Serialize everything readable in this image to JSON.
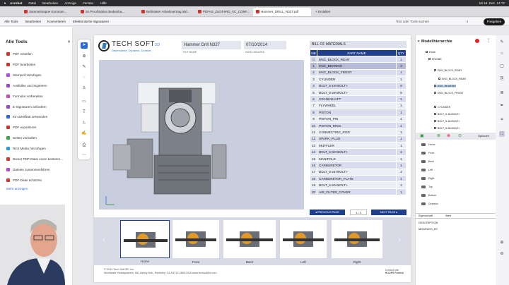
{
  "mac_menu": {
    "app": "Acrobat",
    "items": [
      "Datei",
      "Bearbeiten",
      "Anzeige",
      "Fenster",
      "Hilfe"
    ],
    "clock": "Mi 18. Dez. 14:72"
  },
  "tabs": [
    "Sammelmappe Komman...",
    "55 ProofStation Bedienha...",
    "Befristeter Arbeitsvertrag inkl...",
    "PDFAS_ZUGFeRD_XC_COMF...",
    "Hammer_DRILL_N327.pdf",
    "Erstellen"
  ],
  "menubar": {
    "items": [
      "Alle Tools",
      "Bearbeiten",
      "Konvertieren",
      "Elektronische Signaturen"
    ],
    "search": "Text oder Tools suchen",
    "share": "Freigeben"
  },
  "left_panel": {
    "title": "Alle Tools",
    "tools": [
      "PDF erstellen",
      "PDF bearbeiten",
      "Stempel hinzufügen",
      "Ausfüllen und Signieren",
      "Formular vorbereiten",
      "E-Signaturen anfordern",
      "Ein Zertifikat verwenden",
      "PDF exportieren",
      "Seiten verwalten",
      "Rich Media hinzufügen",
      "Dieser PDF-Datei einen bestimm...",
      "Dateien zusammenführen",
      "PDF-Datei schützen"
    ],
    "tool_colors": [
      "#d0342c",
      "#d0342c",
      "#b04ad0",
      "#9a45d0",
      "#c24ab8",
      "#9a45d0",
      "#2a6ad3",
      "#d0342c",
      "#38a845",
      "#2a9ad3",
      "#d0342c",
      "#b04ad0",
      "#d0342c"
    ],
    "more": "Mehr anzeigen"
  },
  "doc": {
    "brand": "TECH SOFT",
    "brand_3d": "3D",
    "slogan": "Dependable. Dynamic. Durable.",
    "file_name_value": "Hammer Drill N327",
    "file_name_label": "FILE NAME",
    "date_value": "07/10/2014",
    "date_label": "DATE CREATED",
    "bom_title": "BILL OF MATERIALS",
    "bom_headers": [
      "NB",
      "PART NAME",
      "QTY"
    ],
    "bom_rows": [
      [
        "0",
        "ENG_BLOCK_REAR",
        "1"
      ],
      [
        "1",
        "ENG_BEARING",
        "2"
      ],
      [
        "2",
        "ENG_BLOCK_FRONT",
        "1"
      ],
      [
        "3",
        "CYLINDER",
        "1"
      ],
      [
        "4",
        "BOLT_5-18<BOLT>",
        "6"
      ],
      [
        "5",
        "BOLT_5-28<BOLT>",
        "6"
      ],
      [
        "6",
        "CRANKSHAFT",
        "1"
      ],
      [
        "7",
        "FLYWHEEL",
        "1"
      ],
      [
        "8",
        "PISTON",
        "1"
      ],
      [
        "9",
        "PISTON_PIN",
        "1"
      ],
      [
        "10",
        "PISTON_RING",
        "1"
      ],
      [
        "11",
        "CONNECTING_ROD",
        "1"
      ],
      [
        "12",
        "SPARK_PLUG",
        "1"
      ],
      [
        "13",
        "MUFFLER",
        "1"
      ],
      [
        "14",
        "BOLT_5-60<BOLT>",
        "2"
      ],
      [
        "15",
        "MANIFOLD",
        "1"
      ],
      [
        "16",
        "CARBURETOR",
        "1"
      ],
      [
        "17",
        "BOLT_5-24<BOLT>",
        "2"
      ],
      [
        "18",
        "CARBURETOR_PLATE",
        "1"
      ],
      [
        "19",
        "BOLT_5-60<BOLT>",
        "2"
      ],
      [
        "20",
        "AIR_FILTER_COVER",
        "1"
      ]
    ],
    "selected_row": 1,
    "prev": "PREVIOUS PAGE",
    "page": "1 / 3",
    "next": "NEXT PAGE",
    "thumbs": [
      "Home",
      "Front",
      "Back",
      "Left",
      "Right"
    ],
    "footer_line1": "© 2014 Tech Soft 3D, Inc.",
    "footer_line2": "Worldwide Headquarters: 801 Ashby Ave., Berkeley, CA 94710-2805 USA  www.techsoft3d.com",
    "footer_logo1": "Created with",
    "footer_logo2": "HOOPS Publish"
  },
  "right_panel": {
    "title": "Modellhierarchie",
    "tree": [
      "Exam",
      "ENGINE",
      "ENG_BLOCK_REAR",
      "ENG_BLOCK_REAR",
      "ENG_BEARING",
      "ENG_BLOCK_FRONT",
      "CYLINDER",
      "BOLT_5-18<BOLT>",
      "BOLT_5-18<BOLT>",
      "BOLT_5-28<BOLT>"
    ],
    "options": "Optionen",
    "views": [
      "Home",
      "Front",
      "Back",
      "Left",
      "Right",
      "Top",
      "Bottom",
      "Gearbox"
    ],
    "prop_headers": [
      "Eigenschaft",
      "Wert"
    ],
    "props": [
      "DESCRIPTION",
      "MODELED_BY"
    ]
  }
}
